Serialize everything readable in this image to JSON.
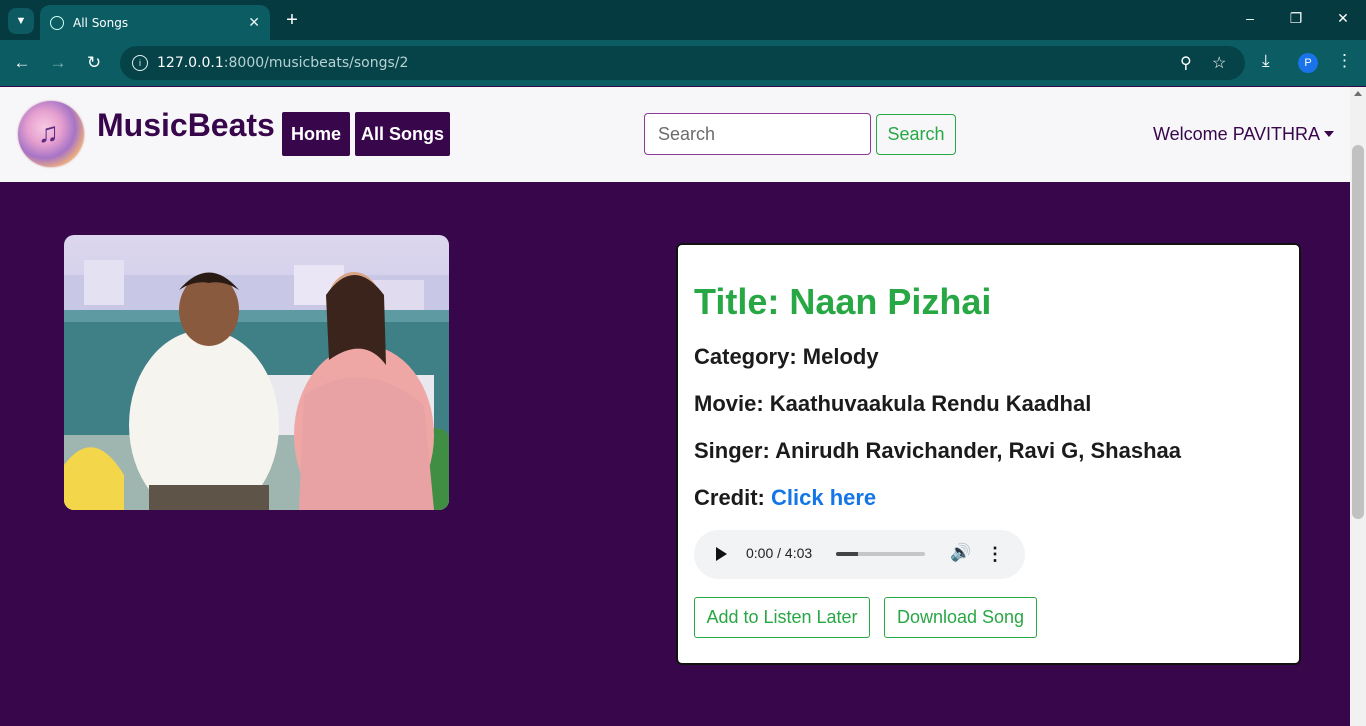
{
  "browser": {
    "tab_title": "All Songs",
    "url_host": "127.0.0.1",
    "url_rest": ":8000/musicbeats/songs/2",
    "profile_initial": "P"
  },
  "navbar": {
    "brand": "MusicBeats",
    "links": [
      "Home",
      "All Songs"
    ],
    "search_placeholder": "Search",
    "search_button": "Search",
    "welcome": "Welcome PAVITHRA"
  },
  "song": {
    "title": "Title: Naan Pizhai",
    "category_label": "Category: ",
    "category": "Melody",
    "movie_label": "Movie: ",
    "movie": "Kaathuvaakula Rendu Kaadhal",
    "singer_label": "Singer: ",
    "singer": "Anirudh Ravichander, Ravi G, Shashaa",
    "credit_label": "Credit: ",
    "credit_link": "Click here"
  },
  "player": {
    "time": "0:00 / 4:03",
    "progress": 0.25
  },
  "actions": {
    "listen_later": "Add to Listen Later",
    "download": "Download Song"
  },
  "colors": {
    "page_bg": "#38064a",
    "accent_green": "#28a745",
    "link_blue": "#1476e6"
  }
}
